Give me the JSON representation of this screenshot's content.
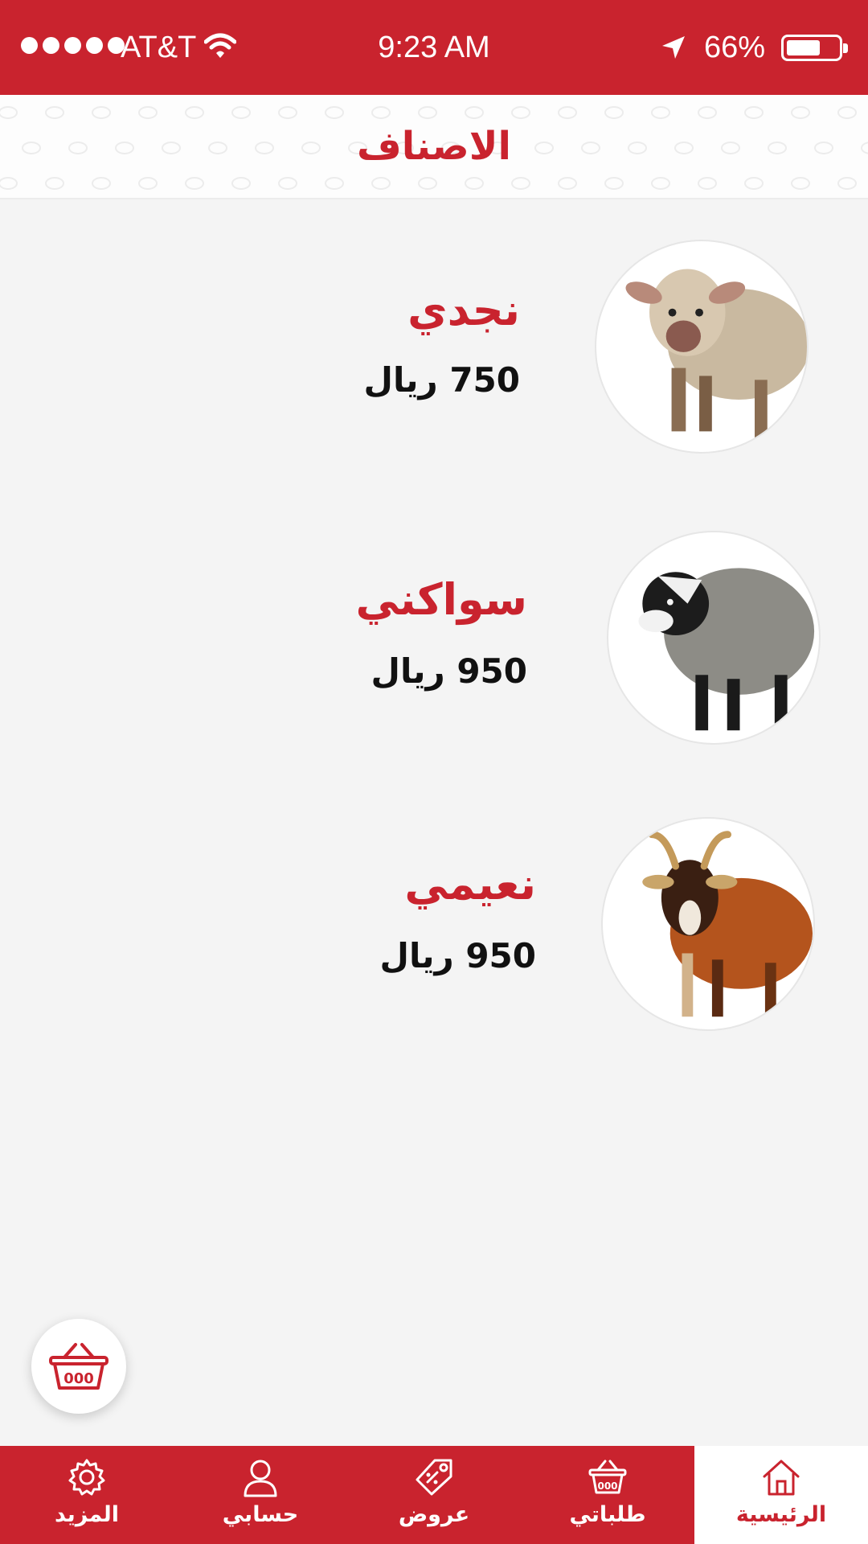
{
  "status_bar": {
    "carrier": "AT&T",
    "time": "9:23 AM",
    "battery_text": "66%",
    "battery_level": 0.66
  },
  "header": {
    "title": "الاصناف"
  },
  "products": [
    {
      "name": "نجدي",
      "price": "750 ريال",
      "image": "sheep-naajdi"
    },
    {
      "name": "سواكني",
      "price": "950 ريال",
      "image": "sheep-sawakni"
    },
    {
      "name": "نعيمي",
      "price": "950 ريال",
      "image": "goat-naimi"
    }
  ],
  "cart_button": {
    "icon": "basket-icon"
  },
  "tabbar": {
    "tabs": [
      {
        "label": "المزيد",
        "icon": "gear-icon",
        "active": false
      },
      {
        "label": "حسابي",
        "icon": "user-icon",
        "active": false
      },
      {
        "label": "عروض",
        "icon": "tag-icon",
        "active": false
      },
      {
        "label": "طلباتي",
        "icon": "basket-icon",
        "active": false
      },
      {
        "label": "الرئيسية",
        "icon": "home-icon",
        "active": true
      }
    ]
  },
  "colors": {
    "brand": "#c9232e",
    "background": "#f4f4f4",
    "price_text": "#111111"
  }
}
